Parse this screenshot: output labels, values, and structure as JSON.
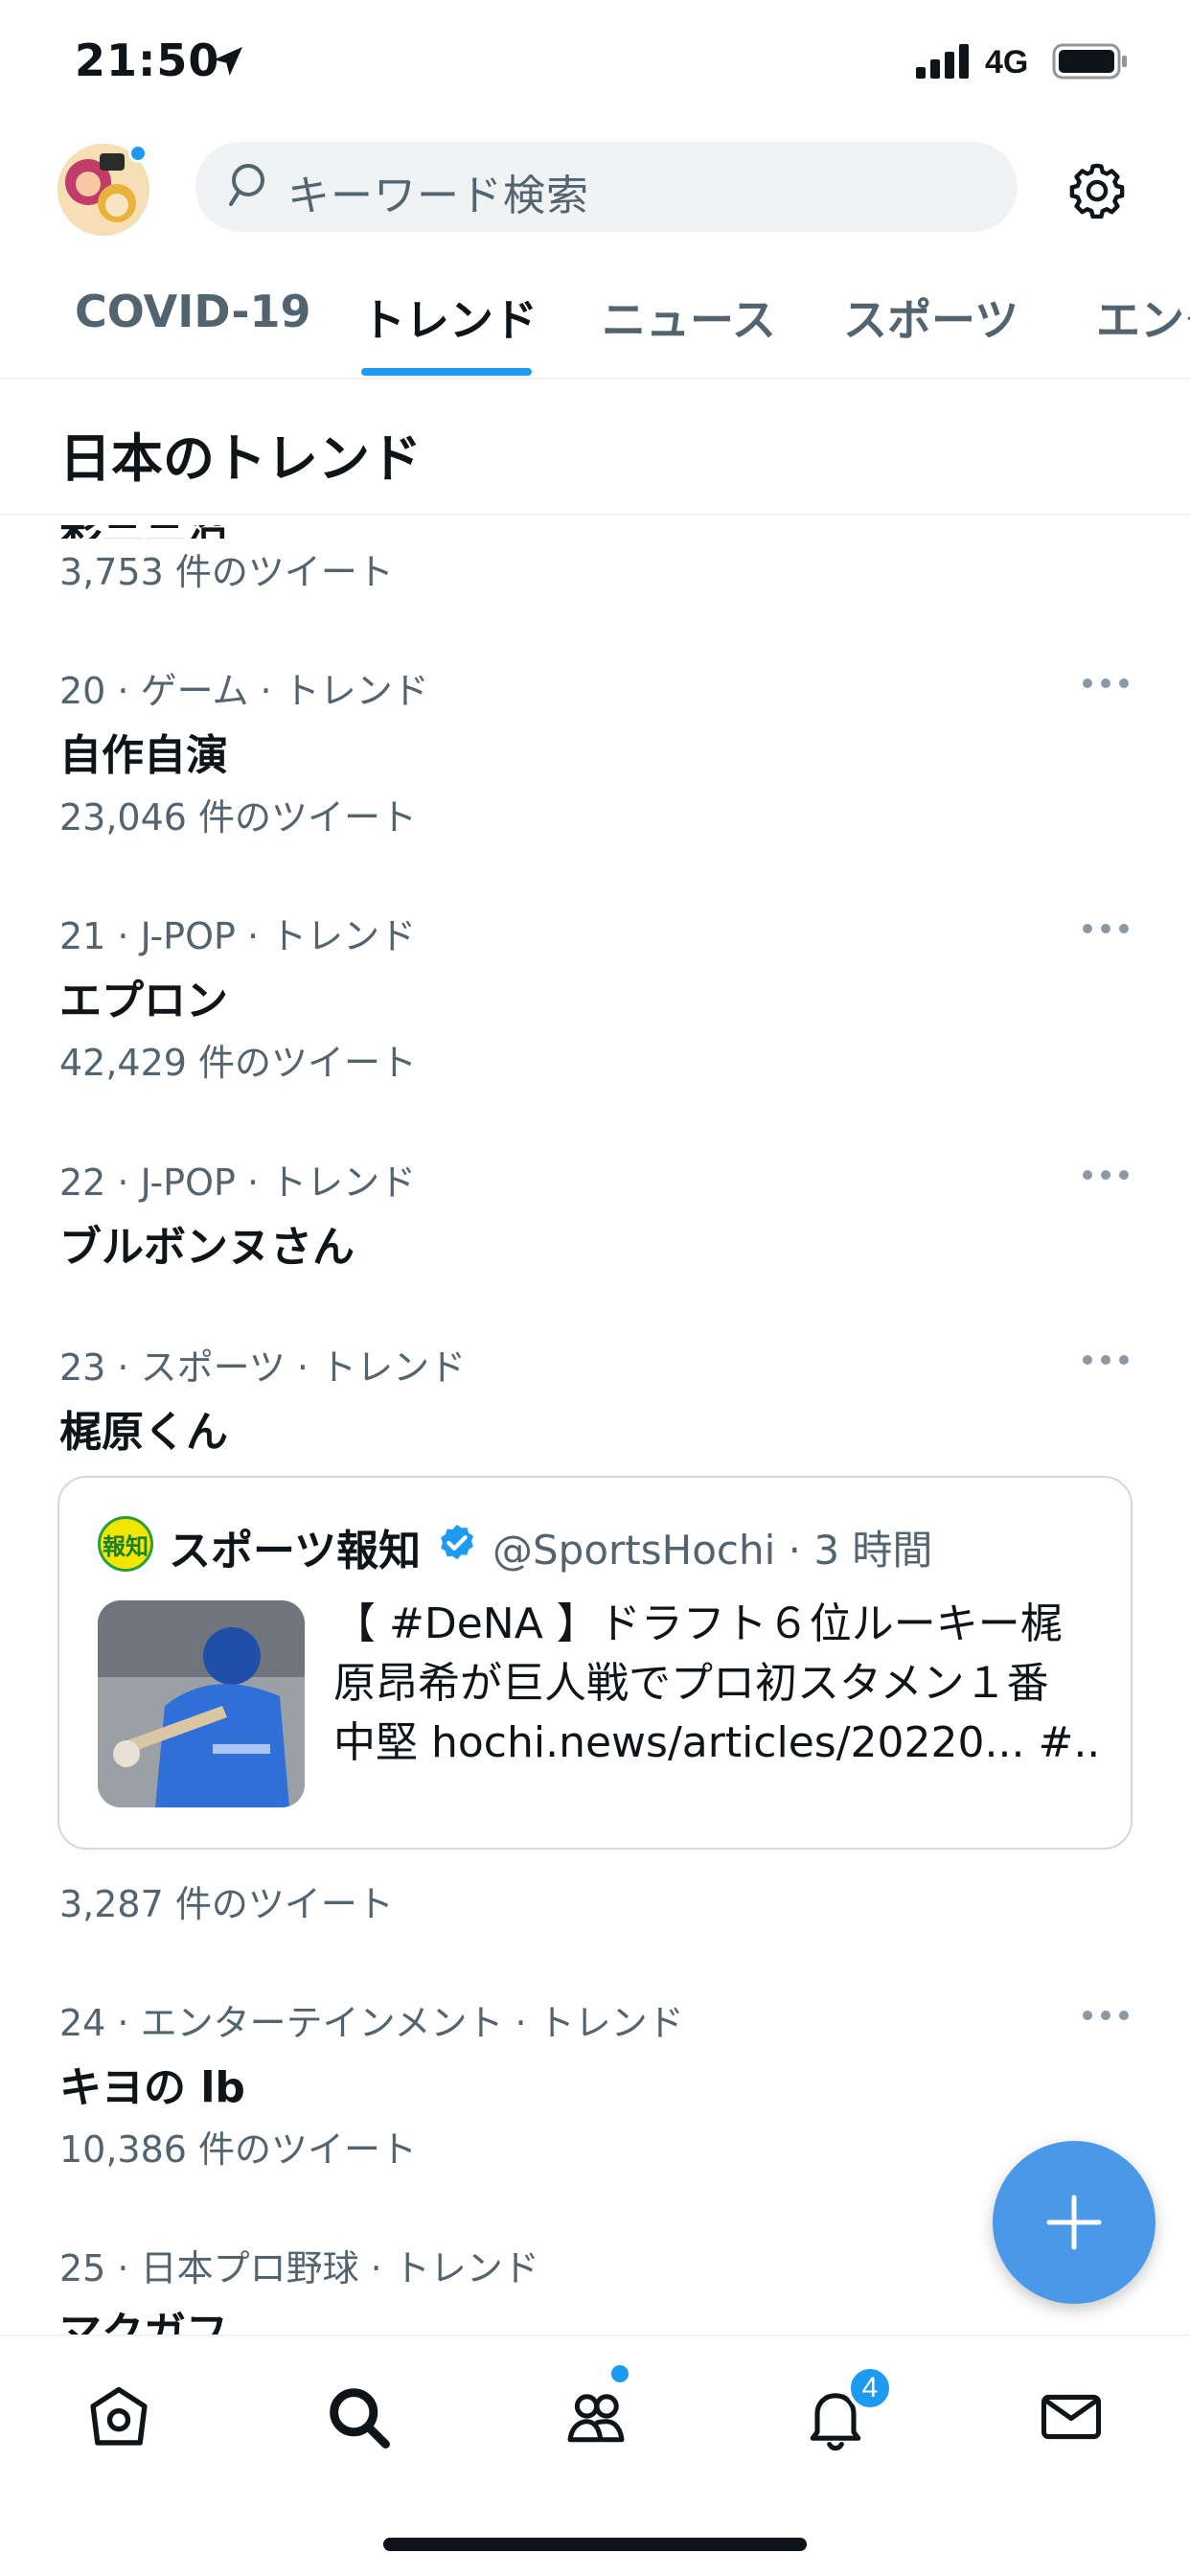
{
  "status_bar": {
    "time": "21:50",
    "network": "4G"
  },
  "header": {
    "search_placeholder": "キーワード検索"
  },
  "tabs": [
    {
      "label": "COVID-19",
      "active": false
    },
    {
      "label": "トレンド",
      "active": true
    },
    {
      "label": "ニュース",
      "active": false
    },
    {
      "label": "スポーツ",
      "active": false
    },
    {
      "label": "エンタ",
      "active": false
    }
  ],
  "section_title": "日本のトレンド",
  "partial_trend": {
    "clipped_text": "彩三三沼",
    "tweet_count": "3,753 件のツイート"
  },
  "trends": [
    {
      "meta": "20 · ゲーム · トレンド",
      "name": "自作自演",
      "tweet_count": "23,046 件のツイート"
    },
    {
      "meta": "21 · J-POP · トレンド",
      "name": "エプロン",
      "tweet_count": "42,429 件のツイート"
    },
    {
      "meta": "22 · J-POP · トレンド",
      "name": "ブルボンヌさん"
    },
    {
      "meta": "23 · スポーツ · トレンド",
      "name": "梶原くん",
      "tweet_count": "3,287 件のツイート"
    },
    {
      "meta": "24 · エンターテインメント · トレンド",
      "name": "キヨの lb",
      "tweet_count": "10,386 件のツイート"
    },
    {
      "meta": "25 · 日本プロ野球 · トレンド",
      "name": "マクガフ"
    }
  ],
  "tweet_card": {
    "logo_text": "報知",
    "name": "スポーツ報知",
    "handle": "@SportsHochi · 3 時間",
    "text_lines": [
      "【 #DeNA 】ドラフト６位ルーキー梶",
      "原昂希が巨人戦でプロ初スタメン１番",
      "中堅 hochi.news/articles/20220... #..."
    ]
  },
  "bottom_nav": {
    "notification_badge": "4"
  },
  "colors": {
    "accent": "#1d9bf0",
    "secondary_text": "#536471",
    "primary_text": "#0f1419"
  }
}
